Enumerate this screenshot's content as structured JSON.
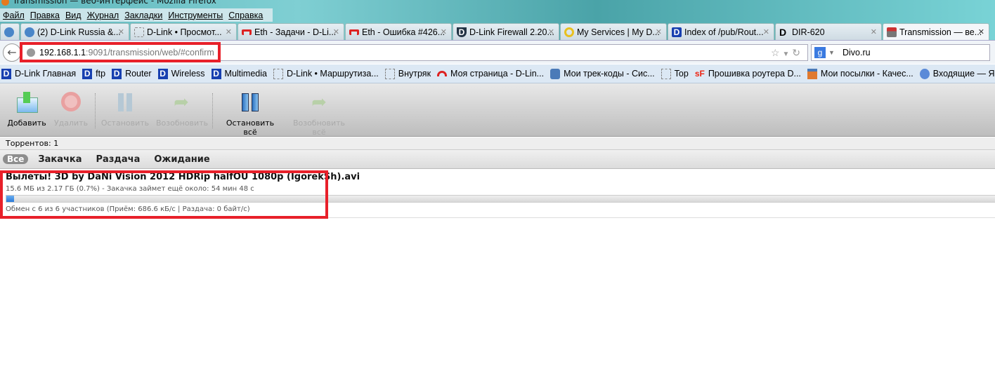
{
  "window": {
    "title": "Transmission — веб-интерфейс - Mozilla Firefox"
  },
  "menu": [
    "Файл",
    "Правка",
    "Вид",
    "Журнал",
    "Закладки",
    "Инструменты",
    "Справка"
  ],
  "tabs": [
    {
      "label": "(2) D-Link Russia &...",
      "icon": "dlink-forum-icon"
    },
    {
      "label": "D-Link • Просмот...",
      "icon": "blank-page-icon"
    },
    {
      "label": "Eth - Задачи - D-Li...",
      "icon": "redmine-icon"
    },
    {
      "label": "Eth - Ошибка #426...",
      "icon": "redmine-icon"
    },
    {
      "label": "D-Link Firewall 2.20...",
      "icon": "dlink-shield-icon"
    },
    {
      "label": "My Services | My D...",
      "icon": "mydlink-icon"
    },
    {
      "label": "Index of /pub/Rout...",
      "icon": "dlink-icon"
    },
    {
      "label": "DIR-620",
      "icon": "dlink-icon"
    },
    {
      "label": "Transmission — ве...",
      "icon": "transmission-icon",
      "active": true
    }
  ],
  "address": {
    "host": "192.168.1.1",
    "rest": ":9091/transmission/web/#confirm"
  },
  "search": {
    "value": "Divo.ru"
  },
  "bookmarks": [
    {
      "label": "D-Link Главная",
      "icon": "dlink"
    },
    {
      "label": "ftp",
      "icon": "dlink"
    },
    {
      "label": "Router",
      "icon": "dlink"
    },
    {
      "label": "Wireless",
      "icon": "dlink"
    },
    {
      "label": "Multimedia",
      "icon": "dlink"
    },
    {
      "label": "D-Link •  Маршрутиза...",
      "icon": "blank"
    },
    {
      "label": "Внутряк",
      "icon": "blank"
    },
    {
      "label": "Моя страница - D-Lin...",
      "icon": "redmine"
    },
    {
      "label": "Мои трек-коды - Сис...",
      "icon": "package"
    },
    {
      "label": "Top",
      "icon": "blank"
    },
    {
      "label": "Прошивка роутера D...",
      "icon": "sf"
    },
    {
      "label": "Мои посылки - Качес...",
      "icon": "gift"
    },
    {
      "label": "Входящие — Яндекс...",
      "icon": "mail"
    }
  ],
  "toolbar": {
    "add": "Добавить",
    "remove": "Удалить",
    "pause": "Остановить",
    "resume": "Возобновить",
    "pause_all": "Остановить всё",
    "resume_all": "Возобновить всё"
  },
  "status": {
    "torrents": "Торрентов: 1"
  },
  "filters": [
    "Все",
    "Закачка",
    "Раздача",
    "Ожидание"
  ],
  "torrent": {
    "name": "Вылеты! 3D by DaNi Vision 2012 HDRip halfOU 1080p (IgorekSh).avi",
    "progress_text": "15.6 МБ из 2.17 ГБ (0.7%) - Закачка займет ещё около: 54 мин 48 с",
    "progress_percent": 0.7,
    "peers_text": "Обмен с 6 из 6 участников (Приём: 686.6 кБ/с | Раздача: 0 байт/с)"
  },
  "colors": {
    "highlight": "#e8202a",
    "progress": "#2a7ad8"
  }
}
